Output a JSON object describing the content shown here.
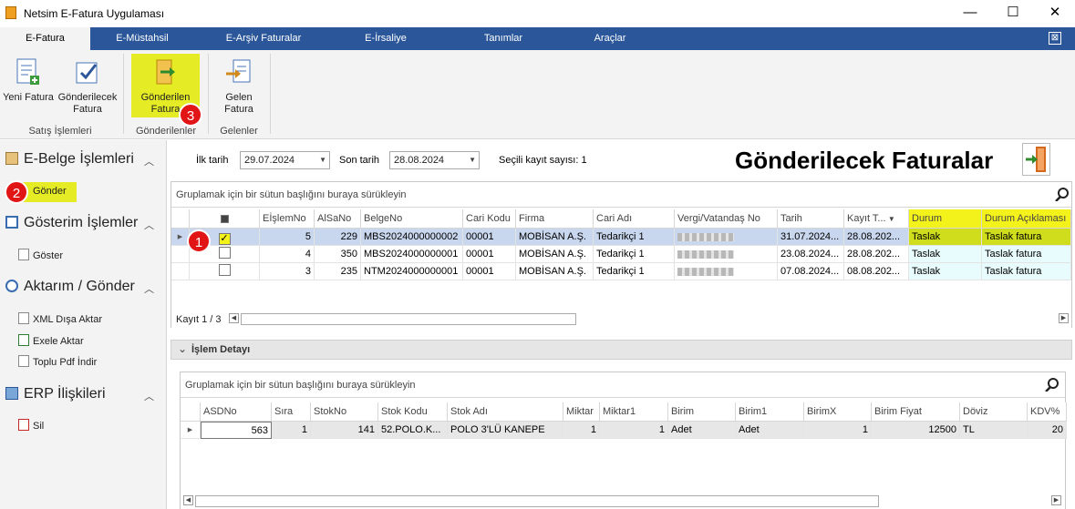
{
  "window": {
    "title": "Netsim E-Fatura Uygulaması",
    "minimize": "—",
    "maximize": "☐",
    "close": "✕"
  },
  "menu": {
    "tabs": [
      "E-Fatura",
      "E-Müstahsil",
      "E-Arşiv Faturalar",
      "E-İrsaliye",
      "Tanımlar",
      "Araçlar"
    ],
    "options_glyph": "⊠"
  },
  "ribbon": {
    "buttons": {
      "new_invoice": "Yeni Fatura",
      "to_send_1": "Gönderilecek",
      "to_send_2": "Fatura",
      "sent_1": "Gönderilen",
      "sent_2": "Fatura",
      "incoming_1": "Gelen",
      "incoming_2": "Fatura"
    },
    "groups": {
      "sales": "Satış İşlemleri",
      "sent": "Gönderilenler",
      "incoming": "Gelenler"
    }
  },
  "badges": {
    "b1": "1",
    "b2": "2",
    "b3": "3"
  },
  "sidebar": {
    "groups": {
      "ebelge": "E-Belge İşlemleri",
      "display": "Gösterim İşlemler",
      "transfer": "Aktarım / Gönder",
      "erp": "ERP İlişkileri"
    },
    "items": {
      "send": "Gönder",
      "show": "Göster",
      "xml": "XML Dışa Aktar",
      "excel": "Exele Aktar",
      "pdf": "Toplu Pdf İndir",
      "delete": "Sil"
    },
    "chevron": "︿"
  },
  "filters": {
    "first_date_label": "İlk tarih",
    "first_date": "29.07.2024",
    "last_date_label": "Son tarih",
    "last_date": "28.08.2024",
    "selected_count": "Seçili kayıt sayısı: 1"
  },
  "heading": "Gönderilecek Faturalar",
  "grid1": {
    "group_hint": "Gruplamak için bir sütun başlığını buraya sürükleyin",
    "columns": [
      "EİşlemNo",
      "AlSaNo",
      "BelgeNo",
      "Cari Kodu",
      "Firma",
      "Cari Adı",
      "Vergi/Vatandaş No",
      "Tarih",
      "Kayıt T...",
      "Durum",
      "Durum Açıklaması"
    ],
    "rows": [
      {
        "eislem": "5",
        "alsa": "229",
        "belge": "MBS2024000000002",
        "cari": "00001",
        "firma": "MOBİSAN A.Ş.",
        "cariadi": "Tedarikçi 1",
        "tarih": "31.07.2024...",
        "kayit": "28.08.202...",
        "durum": "Taslak",
        "aciklama": "Taslak fatura",
        "checked": true
      },
      {
        "eislem": "4",
        "alsa": "350",
        "belge": "MBS2024000000001",
        "cari": "00001",
        "firma": "MOBİSAN A.Ş.",
        "cariadi": "Tedarikçi 1",
        "tarih": "23.08.2024...",
        "kayit": "28.08.202...",
        "durum": "Taslak",
        "aciklama": "Taslak fatura",
        "checked": false
      },
      {
        "eislem": "3",
        "alsa": "235",
        "belge": "NTM2024000000001",
        "cari": "00001",
        "firma": "MOBİSAN A.Ş.",
        "cariadi": "Tedarikçi 1",
        "tarih": "07.08.2024...",
        "kayit": "08.08.202...",
        "durum": "Taslak",
        "aciklama": "Taslak fatura",
        "checked": false
      }
    ],
    "record_info": "Kayıt 1 / 3"
  },
  "detail": {
    "title": "İşlem Detayı",
    "expand_glyph": "⌄"
  },
  "grid2": {
    "group_hint": "Gruplamak için bir sütun başlığını buraya sürükleyin",
    "columns": [
      "ASDNo",
      "Sıra",
      "StokNo",
      "Stok Kodu",
      "Stok Adı",
      "Miktar",
      "Miktar1",
      "Birim",
      "Birim1",
      "BirimX",
      "Birim Fiyat",
      "Döviz",
      "KDV%"
    ],
    "row": {
      "asdno": "563",
      "sira": "1",
      "stokno": "141",
      "stokkodu": "52.POLO.K...",
      "stokadi": "POLO 3'LÜ KANEPE",
      "miktar": "1",
      "miktar1": "1",
      "birim": "Adet",
      "birim1": "Adet",
      "birimx": "1",
      "fiyat": "12500",
      "doviz": "TL",
      "kdv": "20"
    }
  },
  "colors": {
    "menubar": "#2b579a",
    "highlight": "#f4f21b",
    "badge": "#e11515",
    "selected_row": "#c9d7ee"
  }
}
